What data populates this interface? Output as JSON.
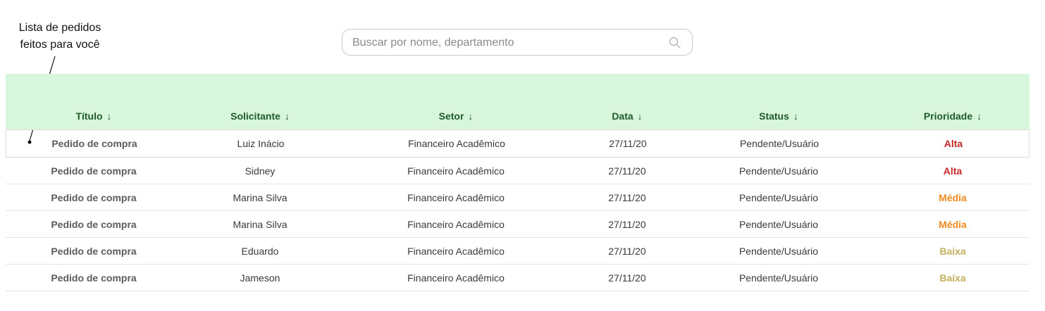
{
  "annotation": {
    "line1": "Lista de pedidos",
    "line2": "feitos para você"
  },
  "search": {
    "placeholder": "Buscar por nome, departamento",
    "icon": "search-icon"
  },
  "colors": {
    "header_bg": "#d8f6dc",
    "header_text": "#1f5a2b",
    "priority_alta": "#c62828",
    "priority_media": "#ef8a1f",
    "priority_baixa": "#c2b15a"
  },
  "table": {
    "columns": [
      {
        "label": "Título",
        "sort_icon": "arrow-down-icon"
      },
      {
        "label": "Solicitante",
        "sort_icon": "arrow-down-icon"
      },
      {
        "label": "Setor",
        "sort_icon": "arrow-down-icon"
      },
      {
        "label": "Data",
        "sort_icon": "arrow-down-icon"
      },
      {
        "label": "Status",
        "sort_icon": "arrow-down-icon"
      },
      {
        "label": "Prioridade",
        "sort_icon": "arrow-down-icon"
      }
    ],
    "rows": [
      {
        "titulo": "Pedido de compra",
        "solicitante": "Luiz Inácio",
        "setor": "Financeiro Acadêmico",
        "data": "27/11/20",
        "status": "Pendente/Usuário",
        "prioridade": "Alta",
        "prioridade_color": "#c62828"
      },
      {
        "titulo": "Pedido de compra",
        "solicitante": "Sidney",
        "setor": "Financeiro Acadêmico",
        "data": "27/11/20",
        "status": "Pendente/Usuário",
        "prioridade": "Alta",
        "prioridade_color": "#c62828"
      },
      {
        "titulo": "Pedido de compra",
        "solicitante": "Marina Silva",
        "setor": "Financeiro Acadêmico",
        "data": "27/11/20",
        "status": "Pendente/Usuário",
        "prioridade": "Média",
        "prioridade_color": "#ef8a1f"
      },
      {
        "titulo": "Pedido de compra",
        "solicitante": "Marina Silva",
        "setor": "Financeiro Acadêmico",
        "data": "27/11/20",
        "status": "Pendente/Usuário",
        "prioridade": "Média",
        "prioridade_color": "#ef8a1f"
      },
      {
        "titulo": "Pedido de compra",
        "solicitante": "Eduardo",
        "setor": "Financeiro Acadêmico",
        "data": "27/11/20",
        "status": "Pendente/Usuário",
        "prioridade": "Baixa",
        "prioridade_color": "#c2b15a"
      },
      {
        "titulo": "Pedido de compra",
        "solicitante": "Jameson",
        "setor": "Financeiro Acadêmico",
        "data": "27/11/20",
        "status": "Pendente/Usuário",
        "prioridade": "Baixa",
        "prioridade_color": "#c2b15a"
      }
    ]
  }
}
